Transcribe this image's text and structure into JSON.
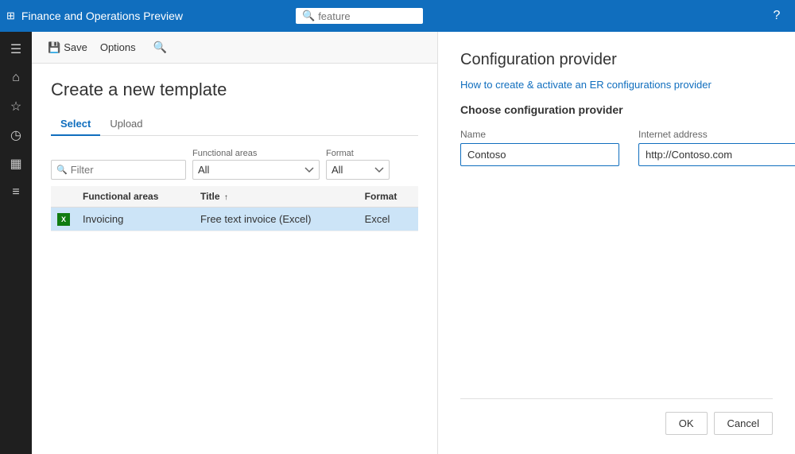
{
  "topbar": {
    "grid_icon": "⊞",
    "title": "Finance and Operations Preview",
    "search_placeholder": "feature",
    "help_icon": "?"
  },
  "sidebar": {
    "items": [
      {
        "name": "hamburger-menu",
        "icon": "☰"
      },
      {
        "name": "home-icon",
        "icon": "⌂"
      },
      {
        "name": "star-icon",
        "icon": "★"
      },
      {
        "name": "clock-icon",
        "icon": "◷"
      },
      {
        "name": "modules-icon",
        "icon": "▦"
      },
      {
        "name": "list-icon",
        "icon": "☰"
      }
    ]
  },
  "toolbar": {
    "save_label": "Save",
    "options_label": "Options",
    "save_icon": "💾",
    "search_icon": "🔍"
  },
  "page": {
    "title": "Create a new template",
    "tabs": [
      {
        "label": "Select",
        "active": true
      },
      {
        "label": "Upload",
        "active": false
      }
    ],
    "filter": {
      "placeholder": "Filter",
      "filter_icon": "🔍"
    },
    "functional_areas_label": "Functional areas",
    "functional_areas_value": "All",
    "format_label": "Format",
    "format_value": "All",
    "table": {
      "columns": [
        {
          "key": "icon",
          "label": ""
        },
        {
          "key": "functional_areas",
          "label": "Functional areas"
        },
        {
          "key": "title",
          "label": "Title"
        },
        {
          "key": "format",
          "label": "Format"
        }
      ],
      "rows": [
        {
          "icon": "excel",
          "functional_areas": "Invoicing",
          "title": "Free text invoice (Excel)",
          "format": "Excel",
          "selected": true
        }
      ]
    }
  },
  "config_panel": {
    "title": "Configuration provider",
    "link": "How to create & activate an ER configurations provider",
    "subtitle": "Choose configuration provider",
    "name_label": "Name",
    "name_value": "Contoso",
    "internet_address_label": "Internet address",
    "internet_address_value": "http://Contoso.com",
    "ok_button": "OK",
    "cancel_button": "Cancel"
  }
}
